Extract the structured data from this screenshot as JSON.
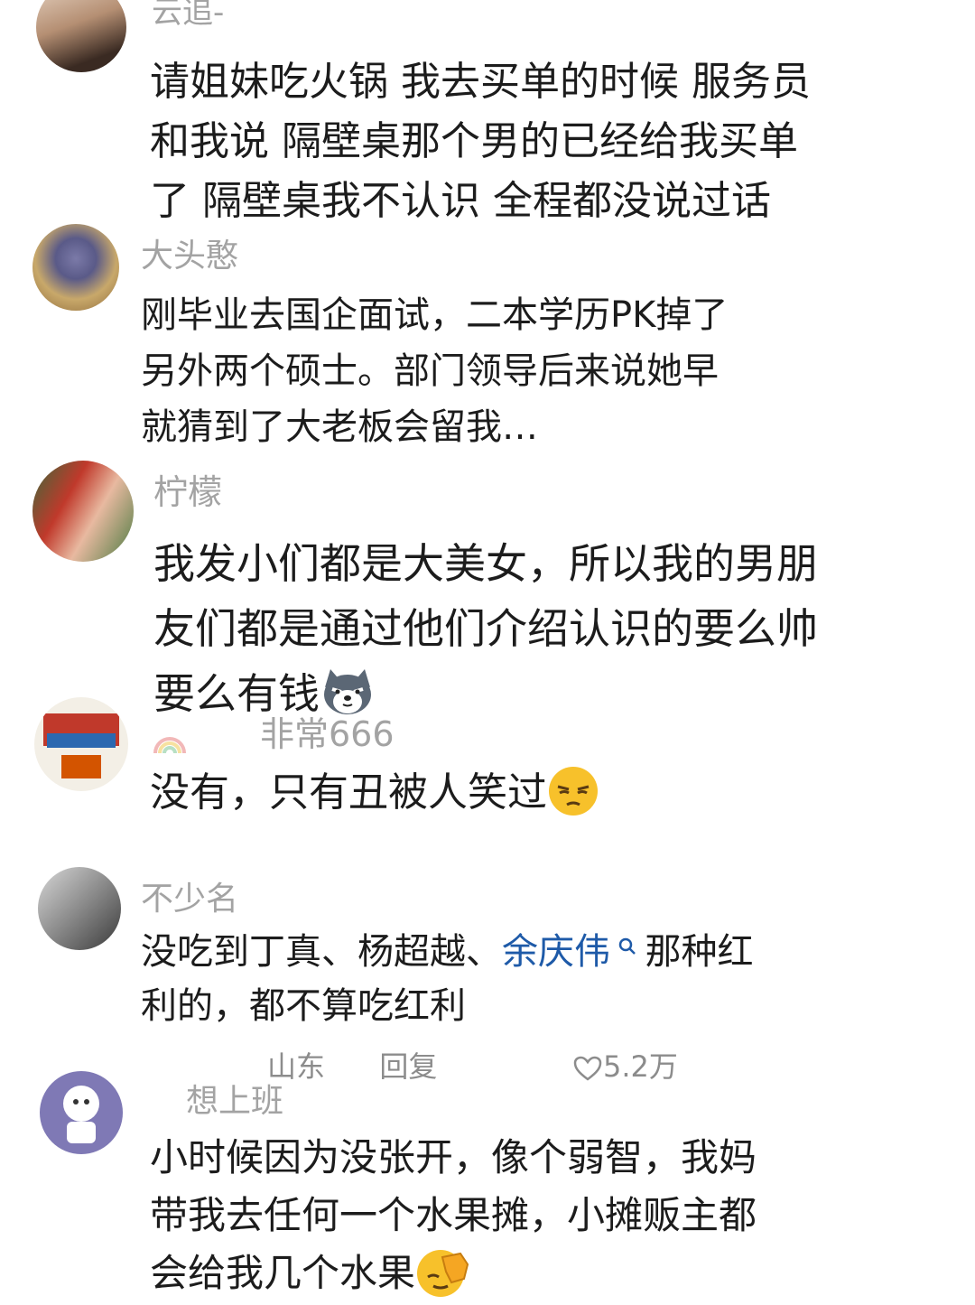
{
  "comments": [
    {
      "username": "云追-",
      "lines": [
        "请姐妹吃火锅 我去买单的时候 服务员",
        "和我说 隔壁桌那个男的已经给我买单",
        "了 隔壁桌我不认识 全程都没说过话"
      ]
    },
    {
      "username": "大头憨",
      "lines": [
        "刚毕业去国企面试，二本学历PK掉了",
        "另外两个硕士。部门领导后来说她早",
        "就猜到了大老板会留我…"
      ]
    },
    {
      "username": "柠檬",
      "lines": [
        "我发小们都是大美女，所以我的男朋",
        "友们都是通过他们介绍认识的要么帅",
        "要么有钱"
      ],
      "emoji": "wolf-emoji"
    },
    {
      "username": "非常666",
      "lines": [
        "没有，只有丑被人笑过"
      ],
      "emoji": "unamused-emoji"
    },
    {
      "username": "不少名",
      "line1_pre": "没吃到丁真、杨超越、",
      "line1_link": "余庆伟",
      "line1_post": "那种红",
      "line2": "利的，都不算吃红利",
      "meta": {
        "location": "山东",
        "reply": "回复",
        "likes": "5.2万"
      }
    },
    {
      "username": "想上班",
      "lines": [
        "小时候因为没张开，像个弱智，我妈",
        "带我去任何一个水果摊，小摊贩主都",
        "会给我几个水果"
      ],
      "emoji": "facepalm-emoji"
    }
  ],
  "icons": {
    "search": "search-icon",
    "heart": "heart-icon"
  },
  "colors": {
    "link": "#1e5aa8",
    "username": "#a3a3a3",
    "text": "#1c1c1c"
  }
}
